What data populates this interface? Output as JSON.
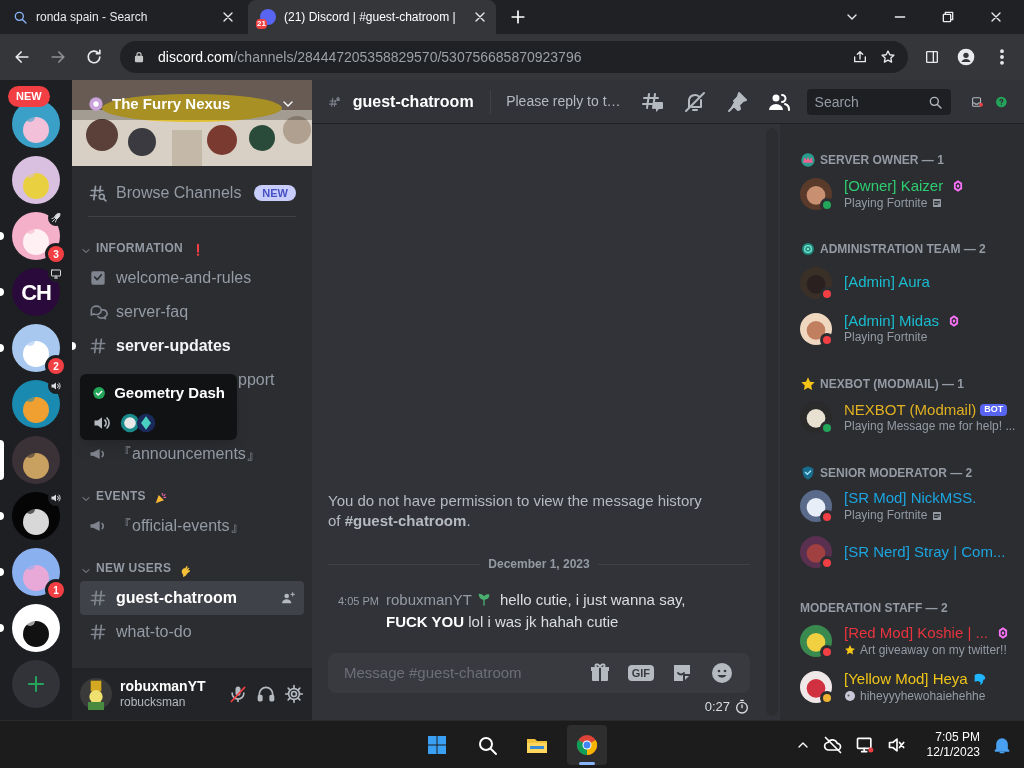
{
  "browser": {
    "tabs": [
      {
        "kind": "search",
        "title": "ronda spain - Search",
        "selected": false
      },
      {
        "kind": "discord",
        "badge": "21",
        "title": "(21) Discord | #guest-chatroom |",
        "selected": true
      }
    ],
    "url_host": "discord.com",
    "url_path": "/channels/284447205358829570/530756685870923796"
  },
  "servers": {
    "new_badge": "NEW",
    "items": [
      {
        "unread": false,
        "selected": false
      },
      {
        "unread": false,
        "selected": false
      },
      {
        "unread": true,
        "selected": false,
        "badge": "3"
      },
      {
        "unread": true,
        "selected": false,
        "label": "CH"
      },
      {
        "unread": true,
        "selected": false,
        "badge": "2"
      },
      {
        "unread": false,
        "selected": false
      },
      {
        "unread": false,
        "selected": true
      },
      {
        "unread": true,
        "selected": false
      },
      {
        "unread": true,
        "selected": false,
        "badge": "1"
      },
      {
        "unread": true,
        "selected": false
      }
    ]
  },
  "sidebar": {
    "server_name": "The Furry Nexus",
    "browse": {
      "label": "Browse Channels",
      "badge": "NEW"
    },
    "categories": [
      {
        "name": "INFORMATION",
        "channels": [
          {
            "kind": "rules",
            "name": "welcome-and-rules",
            "unread": false,
            "selected": false
          },
          {
            "kind": "forum",
            "name": "server-faq",
            "unread": false,
            "selected": false
          },
          {
            "kind": "text",
            "name": "server-updates",
            "unread": true,
            "selected": false
          },
          {
            "kind": "partial",
            "name": "pport"
          },
          {
            "kind": "announcement",
            "name": "『announcements』",
            "unread": false,
            "selected": false
          }
        ]
      },
      {
        "name": "EVENTS",
        "channels": [
          {
            "kind": "announcement",
            "name": "『official-events』",
            "unread": false,
            "selected": false
          }
        ]
      },
      {
        "name": "NEW USERS",
        "channels": [
          {
            "kind": "text",
            "name": "guest-chatroom",
            "unread": false,
            "selected": true
          },
          {
            "kind": "text",
            "name": "what-to-do",
            "unread": false,
            "selected": false
          }
        ]
      }
    ]
  },
  "tooltip": {
    "title": "Geometry Dash"
  },
  "user": {
    "name": "robuxmanYT",
    "tag": "robucksman",
    "muted": true
  },
  "chat": {
    "channel": "guest-chatroom",
    "topic": "Please reply to t…",
    "search_placeholder": "Search",
    "notice": "You do not have permission to view the message history of **#guest-chatroom**.",
    "date": "December 1, 2023",
    "messages": [
      {
        "time": "4:05 PM",
        "author": "robuxmanYT",
        "text": "hello cutie, i just wanna say, **FUCK YOU** lol i was jk hahah cutie"
      }
    ],
    "composer_placeholder": "Message #guest-chatroom",
    "gif_label": "GIF",
    "slowmode": "0:27"
  },
  "members": [
    {
      "title": "SERVER OWNER — 1",
      "people": [
        {
          "name": "[Owner] Kaizer",
          "color": "#2ecc71",
          "presence": {
            "color": "#23a55a"
          },
          "activity": "Playing Fortnite",
          "rich_presence": true,
          "boost": true
        }
      ]
    },
    {
      "title": "ADMINISTRATION TEAM — 2",
      "people": [
        {
          "name": "[Admin] Aura",
          "color": "#1abcd0",
          "presence": {
            "color": "#f23f43"
          }
        },
        {
          "name": "[Admin] Midas",
          "color": "#1abcd0",
          "presence": {
            "color": "#f23f43"
          },
          "activity": "Playing Fortnite",
          "boost": true
        }
      ]
    },
    {
      "title": "NEXBOT (MODMAIL) — 1",
      "people": [
        {
          "name": "NEXBOT (Modmail)",
          "color": "#e0b020",
          "presence": {
            "color": "#23a55a"
          },
          "tag": "BOT",
          "activity": "Playing Message me for help! ..."
        }
      ]
    },
    {
      "title": "SENIOR MODERATOR — 2",
      "people": [
        {
          "name": "[SR Mod] NickMSS.",
          "color": "#1ca5e0",
          "presence": {
            "color": "#f23f43"
          },
          "activity": "Playing Fortnite",
          "rich_presence": true
        },
        {
          "name": "[SR Nerd] Stray | Com...",
          "color": "#1ca5e0",
          "presence": {
            "color": "#f23f43"
          }
        }
      ]
    },
    {
      "title": "MODERATION STAFF — 2",
      "people": [
        {
          "name": "[Red Mod] Koshie | ...",
          "color": "#e8343e",
          "presence": {
            "color": "#f23f43"
          },
          "activity": "Art giveaway on my twitter!!",
          "activity_emoji": true,
          "boost": true
        },
        {
          "name": "[Yellow Mod] Heya",
          "color": "#f0c419",
          "presence": {
            "color": "#f0b232"
          },
          "activity": "hiheyyyhewohaiehehhe",
          "activity_emoji": true,
          "role_icon": true
        }
      ]
    }
  ],
  "taskbar": {
    "apps": [
      {
        "kind": "windows",
        "selected": false
      },
      {
        "kind": "search",
        "selected": false
      },
      {
        "kind": "files",
        "selected": false
      },
      {
        "kind": "chrome",
        "selected": true
      }
    ],
    "time": "7:05 PM",
    "date": "12/1/2023"
  }
}
